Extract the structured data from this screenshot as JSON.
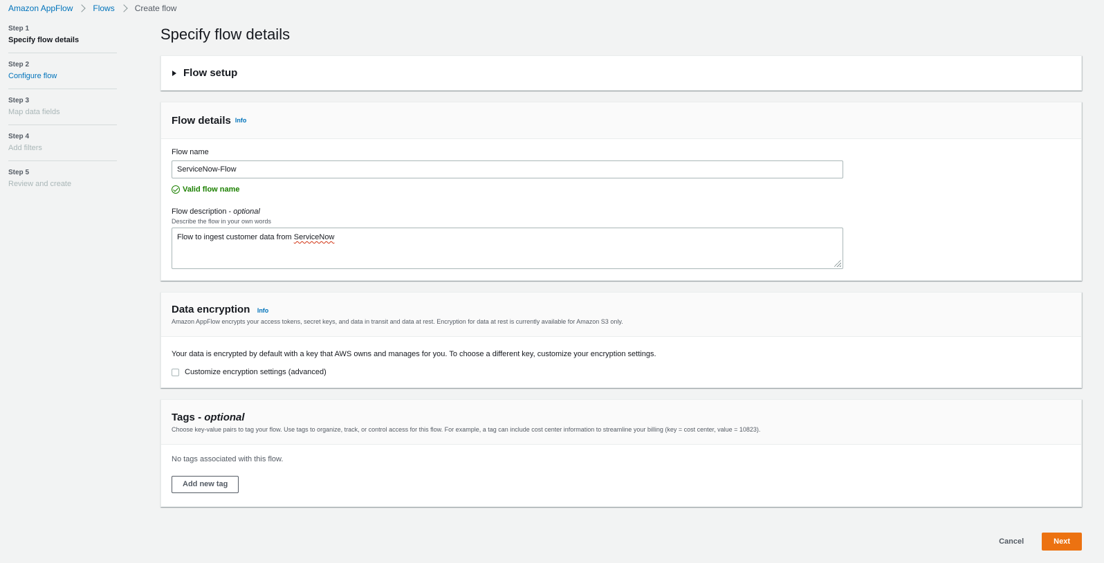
{
  "breadcrumb": {
    "items": [
      "Amazon AppFlow",
      "Flows"
    ],
    "current": "Create flow"
  },
  "steps": [
    {
      "num": "Step 1",
      "label": "Specify flow details"
    },
    {
      "num": "Step 2",
      "label": "Configure flow"
    },
    {
      "num": "Step 3",
      "label": "Map data fields"
    },
    {
      "num": "Step 4",
      "label": "Add filters"
    },
    {
      "num": "Step 5",
      "label": "Review and create"
    }
  ],
  "page": {
    "title": "Specify flow details"
  },
  "flow_setup": {
    "title": "Flow setup"
  },
  "flow_details": {
    "title": "Flow details",
    "info": "Info",
    "name_label": "Flow name",
    "name_value": "ServiceNow-Flow",
    "valid_text": "Valid flow name",
    "desc_label": "Flow description - ",
    "desc_optional": "optional",
    "desc_hint": "Describe the flow in your own words",
    "desc_value_prefix": "Flow to ingest customer data from ",
    "desc_value_misspelled": "ServiceNow"
  },
  "encryption": {
    "title": "Data encryption",
    "info": "Info",
    "desc": "Amazon AppFlow encrypts your access tokens, secret keys, and data in transit and data at rest. Encryption for data at rest is currently available for Amazon S3 only.",
    "body": "Your data is encrypted by default with a key that AWS owns and manages for you. To choose a different key, customize your encryption settings.",
    "checkbox_label": "Customize encryption settings (advanced)"
  },
  "tags": {
    "title": "Tags - ",
    "title_optional": "optional",
    "desc": "Choose key-value pairs to tag your flow. Use tags to organize, track, or control access for this flow. For example, a tag can include cost center information to streamline your billing (key = cost center, value = 10823).",
    "empty": "No tags associated with this flow.",
    "add_button": "Add new tag"
  },
  "actions": {
    "cancel": "Cancel",
    "next": "Next"
  }
}
